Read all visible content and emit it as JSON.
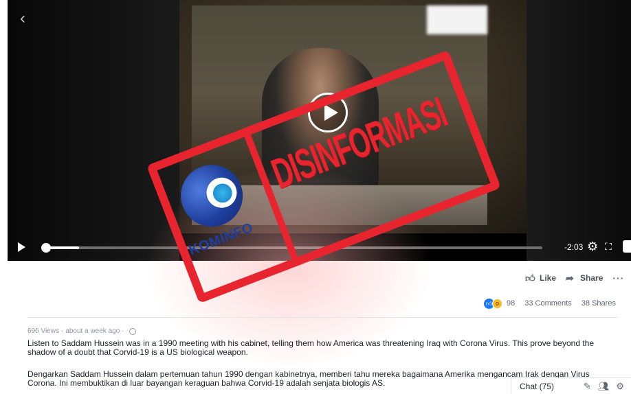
{
  "video": {
    "time_remaining": "-2:03",
    "progress_fraction": 0.07
  },
  "stamp": {
    "word": "DISINFORMASI",
    "logo_text": "KOMINFO",
    "color": "#e8252f"
  },
  "actions": {
    "like": "Like",
    "share": "Share",
    "more": "···"
  },
  "counts": {
    "reactions": "98",
    "comments": "33 Comments",
    "shares": "38 Shares"
  },
  "post": {
    "views": "696 Views",
    "time": "about a week ago",
    "text_en": "Listen to Saddam Hussein was in a 1990 meeting with his cabinet, telling them how America was threatening Iraq with Corona Virus. This prove beyond the shadow of a doubt that Corvid-19 is a US biological weapon.",
    "text_id": "Dengarkan Saddam Hussein dalam pertemuan tahun 1990 dengan kabinetnya, memberi tahu mereka bagaimana Amerika mengancam Irak dengan Virus Corona. Ini membuktikan di luar bayangan keraguan bahwa Corvid-19 adalah senjata biologis AS."
  },
  "chat": {
    "label": "Chat (75)"
  },
  "icons": {
    "back": "chevron-left-icon",
    "play": "play-icon",
    "settings": "gear-icon",
    "fullscreen": "fullscreen-icon",
    "volume": "volume-icon",
    "like": "thumbs-up-icon",
    "share": "share-arrow-icon",
    "globe": "globe-icon"
  }
}
